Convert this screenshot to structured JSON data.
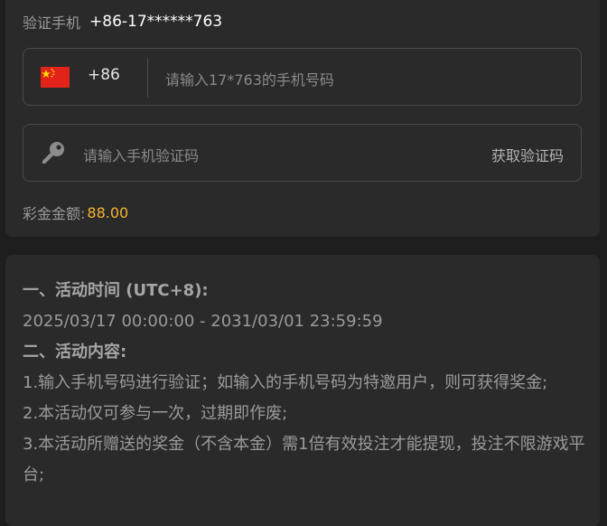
{
  "verify": {
    "label": "验证手机",
    "phone": "+86-17******763"
  },
  "phone_field": {
    "flag_icon": "china-flag-icon",
    "country_code": "+86",
    "placeholder": "请输入17*763的手机号码"
  },
  "code_field": {
    "icon": "key-icon",
    "placeholder": "请输入手机验证码",
    "action_label": "获取验证码"
  },
  "bonus": {
    "label": "彩金金额:",
    "amount": "88.00"
  },
  "rules": {
    "time_heading": "一、活动时间 (UTC+8):",
    "time_range": "2025/03/17 00:00:00 - 2031/03/01 23:59:59",
    "content_heading": "二、活动内容:",
    "items": [
      "1.输入手机号码进行验证；如输入的手机号码为特邀用户，则可获得奖金;",
      "2.本活动仅可参与一次，过期即作废;",
      "3.本活动所赠送的奖金（不含本金）需1倍有效投注才能提现，投注不限游戏平台;"
    ]
  },
  "colors": {
    "background": "#1e1e1f",
    "card": "#2a2a2b",
    "border": "#4a4a4b",
    "accent_amount": "#f7b52c",
    "flag_red": "#e2231a",
    "flag_star": "#ffde00"
  }
}
